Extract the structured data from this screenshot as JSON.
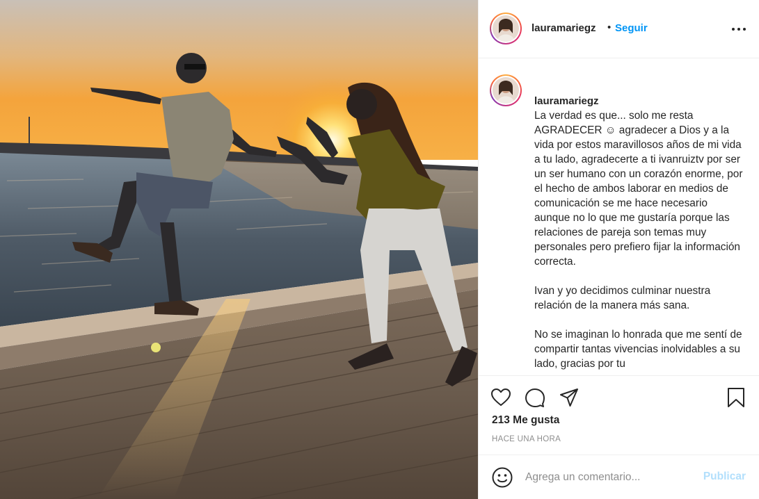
{
  "post": {
    "username": "lauramariegz",
    "separator": "•",
    "follow_label": "Seguir",
    "caption": [
      "La verdad es que... solo me resta AGRADECER ☺ agradecer a Dios y a la vida por estos maravillosos años de mi vida a tu lado, agradecerte a ti ivanruiztv por ser un ser humano con un corazón enorme, por el hecho de ambos laborar en medios de comunicación se me hace necesario aunque no lo que me gustaría porque las relaciones de pareja son temas muy personales pero prefiero fijar la información correcta.",
      "Ivan y yo decidimos culminar nuestra relación de la manera más sana.",
      "No se imaginan lo honrada que me sentí de compartir tantas vivencias inolvidables a su lado, gracias por tu"
    ],
    "likes": "213 Me gusta",
    "time": "HACE UNA HORA"
  },
  "comment_bar": {
    "placeholder": "Agrega un comentario...",
    "publish_label": "Publicar"
  },
  "icons": {
    "more": "more-options-icon",
    "like": "heart-icon",
    "comment": "comment-bubble-icon",
    "share": "paper-plane-icon",
    "save": "bookmark-icon",
    "emoji": "smiley-icon"
  },
  "colors": {
    "link_blue": "#0095f6",
    "publish_disabled": "#b2dffc",
    "muted": "#8e8e8e",
    "text": "#262626",
    "divider": "#efefef"
  }
}
